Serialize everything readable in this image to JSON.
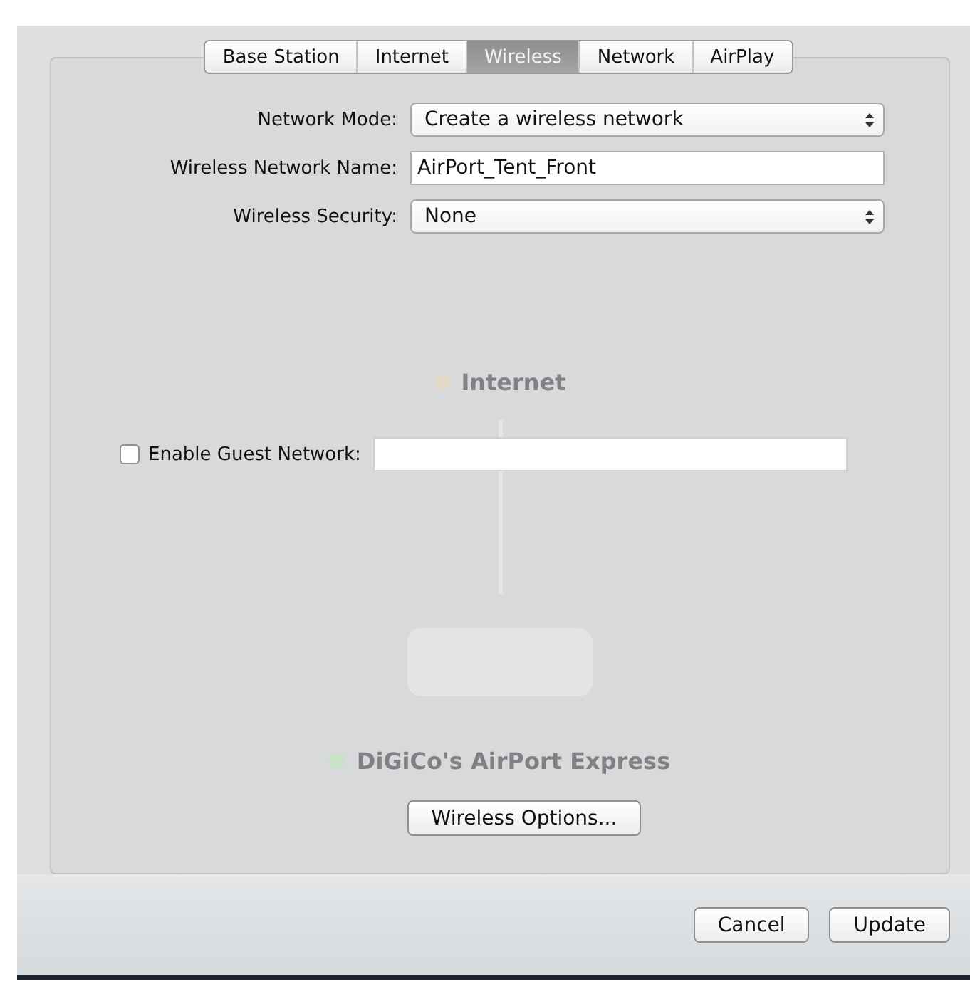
{
  "tabs": [
    {
      "label": "Base Station",
      "selected": false
    },
    {
      "label": "Internet",
      "selected": false
    },
    {
      "label": "Wireless",
      "selected": true
    },
    {
      "label": "Network",
      "selected": false
    },
    {
      "label": "AirPlay",
      "selected": false
    }
  ],
  "form": [
    {
      "kind": "select",
      "label": "Network Mode:",
      "value": "Create a wireless network"
    },
    {
      "kind": "text",
      "label": "Wireless Network Name:",
      "value": "AirPort_Tent_Front"
    },
    {
      "kind": "select",
      "label": "Wireless Security:",
      "value": "None"
    }
  ],
  "guest_network": {
    "label": "Enable Guest Network:",
    "checked": false
  },
  "background_diagram": {
    "internet": {
      "label": "Internet",
      "color": "#e6d8c6"
    },
    "device": {
      "label": "DiGiCo's AirPort Express",
      "color": "#c8e2c8"
    }
  },
  "wireless_options_button": "Wireless Options...",
  "buttons": [
    "Cancel",
    "Update"
  ]
}
